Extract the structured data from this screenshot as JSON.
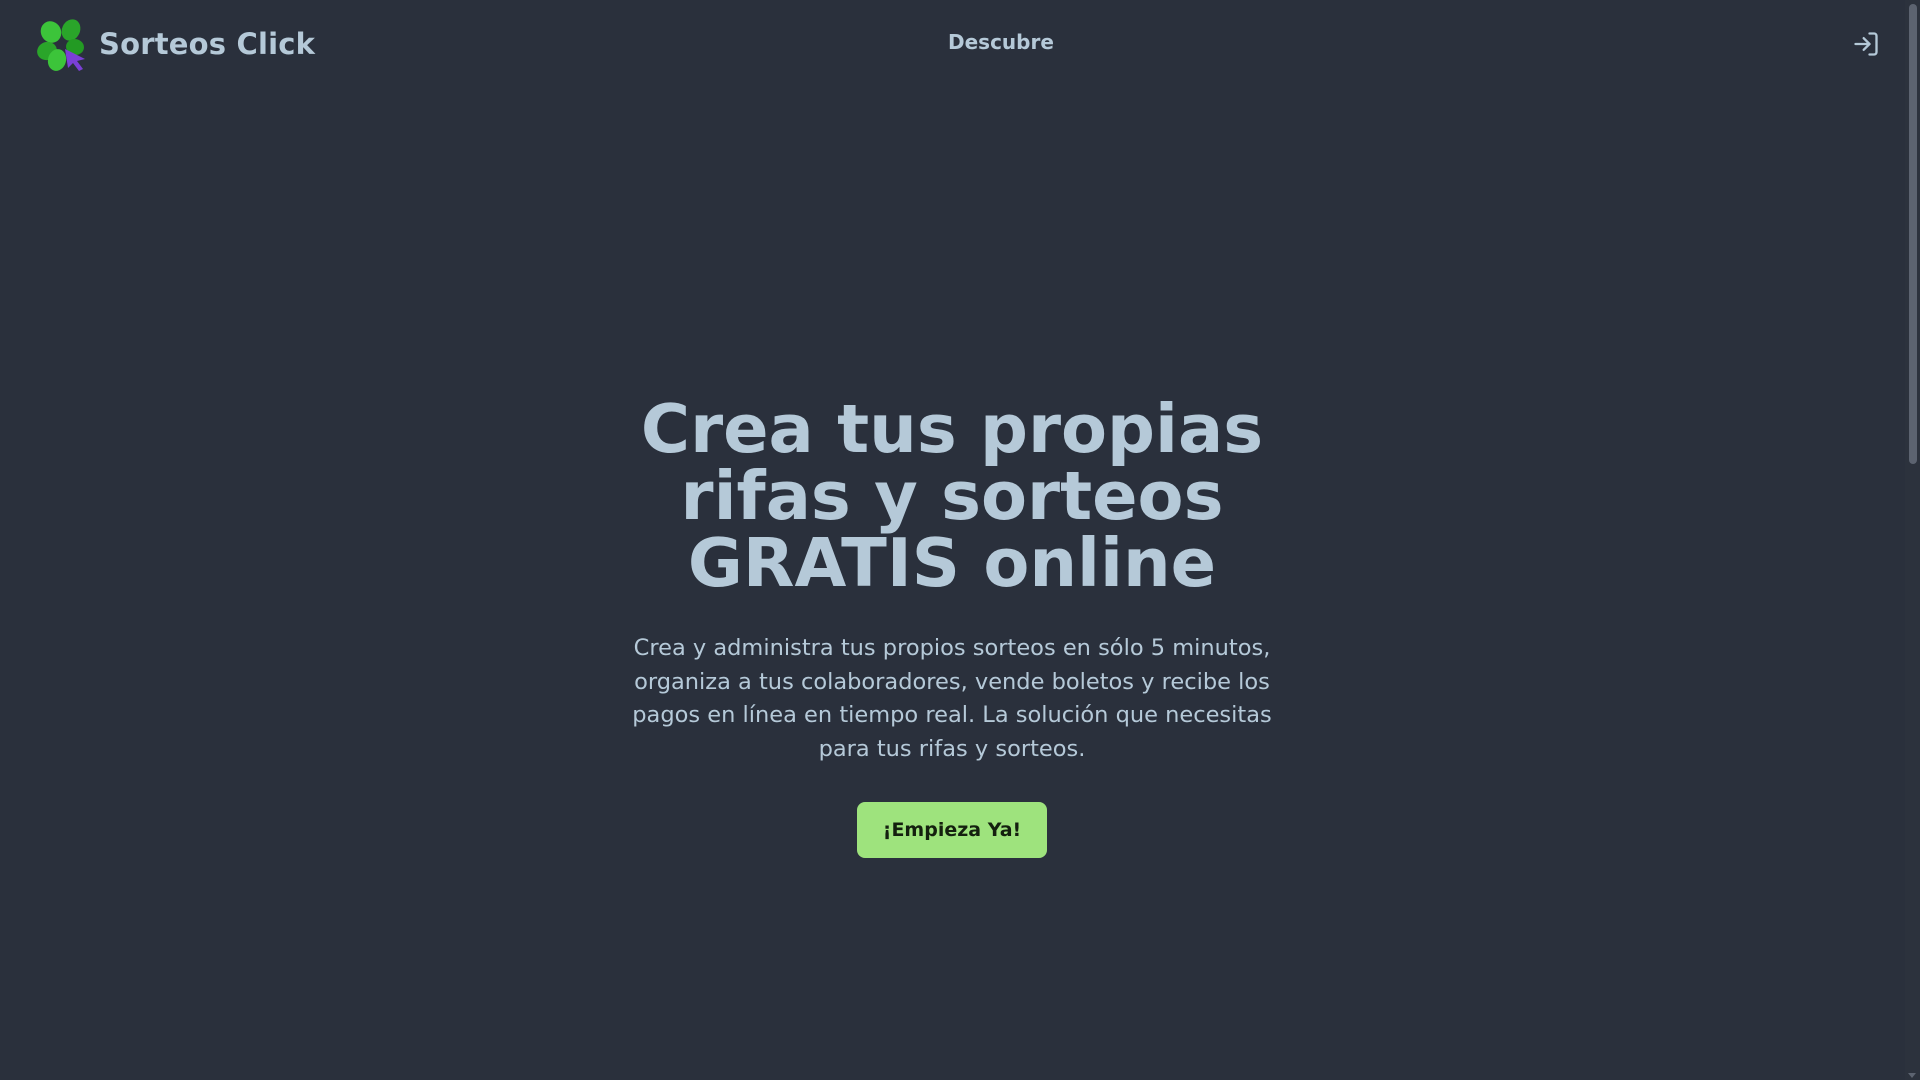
{
  "header": {
    "brand_name": "Sorteos Click",
    "nav_link": "Descubre",
    "login_icon": "login-icon"
  },
  "hero": {
    "title": "Crea tus propias rifas y sorteos GRATIS online",
    "description": "Crea y administra tus propios sorteos en sólo 5 minutos, organiza a tus colaboradores, vende boletos y recibe los pagos en línea en tiempo real. La solución que necesitas para tus rifas y sorteos.",
    "cta_label": "¡Empieza Ya!"
  },
  "colors": {
    "background": "#2a303c",
    "text": "#b5c9d8",
    "cta_background": "#9ee37d",
    "logo_green": "#2fb82f",
    "logo_cursor": "#7b3fd6"
  }
}
